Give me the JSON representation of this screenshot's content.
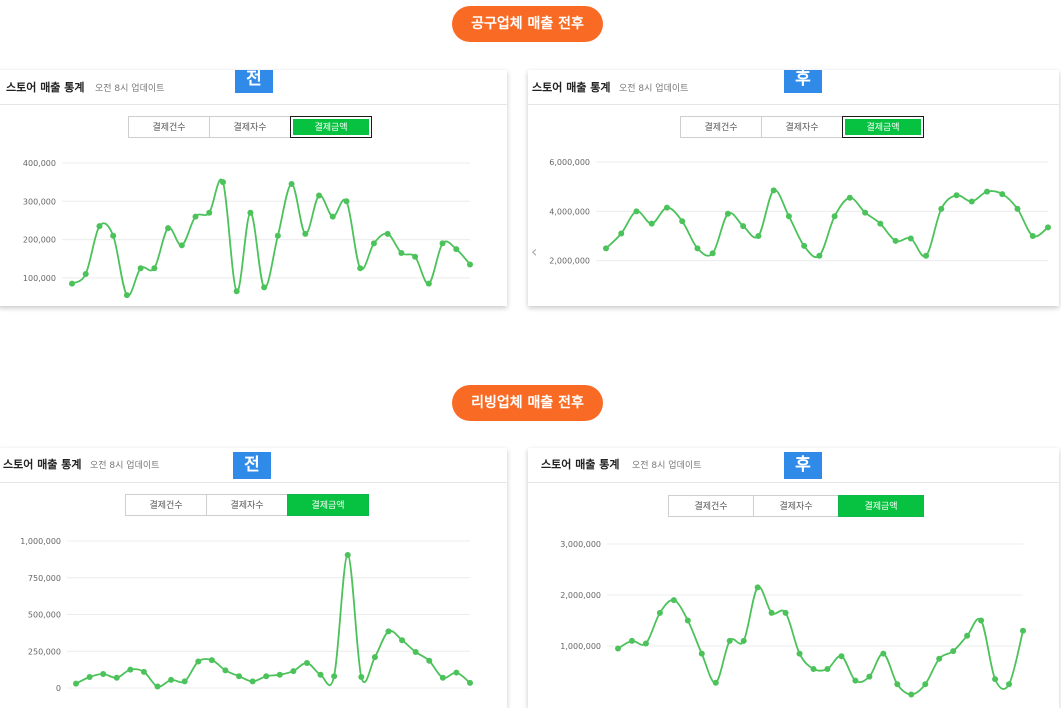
{
  "colors": {
    "badge": "#f96b24",
    "stage_badge": "#2f8ae8",
    "active_tab": "#07c140",
    "line": "#4cc25b",
    "grid": "#ececec"
  },
  "sections": [
    {
      "label": "공구업체 매출 전후"
    },
    {
      "label": "리빙업체 매출 전후"
    }
  ],
  "panels": [
    {
      "title": "스토어 매출 통계",
      "subtitle": "오전 8시 업데이트",
      "stage": "전",
      "tabs": [
        "결제건수",
        "결제자수",
        "결제금액"
      ],
      "active_tab": 2
    },
    {
      "title": "스토어 매출 통계",
      "subtitle": "오전 8시 업데이트",
      "stage": "후",
      "tabs": [
        "결제건수",
        "결제자수",
        "결제금액"
      ],
      "active_tab": 2,
      "nav_icon": "chevron-left-icon"
    },
    {
      "title": "스토어 매출 통계",
      "subtitle": "오전 8시 업데이트",
      "stage": "전",
      "tabs": [
        "결제건수",
        "결제자수",
        "결제금액"
      ],
      "active_tab": 2
    },
    {
      "title": "스토어 매출 통계",
      "subtitle": "오전 8시 업데이트",
      "stage": "후",
      "tabs": [
        "결제건수",
        "결제자수",
        "결제금액"
      ],
      "active_tab": 2
    }
  ],
  "chart_data": [
    {
      "type": "line",
      "ylim": [
        50000,
        400000
      ],
      "yticks": [
        100000,
        200000,
        300000,
        400000
      ],
      "ytick_labels": [
        "100,000",
        "200,000",
        "300,000",
        "400,000"
      ],
      "grid": true,
      "series": [
        {
          "values": [
            85000,
            110000,
            235000,
            210000,
            55000,
            125000,
            125000,
            230000,
            185000,
            260000,
            270000,
            350000,
            65000,
            270000,
            75000,
            210000,
            345000,
            215000,
            315000,
            260000,
            300000,
            125000,
            190000,
            215000,
            165000,
            155000,
            85000,
            190000,
            175000,
            135000
          ]
        }
      ]
    },
    {
      "type": "line",
      "ylim": [
        1500000,
        6000000
      ],
      "yticks": [
        2000000,
        4000000,
        6000000
      ],
      "ytick_labels": [
        "2,000,000",
        "4,000,000",
        "6,000,000"
      ],
      "grid": true,
      "series": [
        {
          "values": [
            2500000,
            3100000,
            4000000,
            3500000,
            4150000,
            3600000,
            2500000,
            2300000,
            3900000,
            3400000,
            3000000,
            4850000,
            3800000,
            2600000,
            2200000,
            3800000,
            4550000,
            3950000,
            3500000,
            2800000,
            2900000,
            2200000,
            4100000,
            4650000,
            4400000,
            4800000,
            4700000,
            4100000,
            3000000,
            3350000
          ]
        }
      ]
    },
    {
      "type": "line",
      "ylim": [
        0,
        1000000
      ],
      "yticks": [
        0,
        250000,
        500000,
        750000,
        1000000
      ],
      "ytick_labels": [
        "0",
        "250,000",
        "500,000",
        "750,000",
        "1,000,000"
      ],
      "grid": true,
      "series": [
        {
          "values": [
            30000,
            75000,
            95000,
            70000,
            125000,
            110000,
            10000,
            55000,
            45000,
            180000,
            190000,
            120000,
            80000,
            45000,
            80000,
            90000,
            115000,
            170000,
            90000,
            80000,
            905000,
            75000,
            210000,
            385000,
            325000,
            245000,
            185000,
            70000,
            105000,
            35000
          ]
        }
      ]
    },
    {
      "type": "line",
      "ylim": [
        0,
        3000000
      ],
      "yticks": [
        1000000,
        2000000,
        3000000
      ],
      "ytick_labels": [
        "1,000,000",
        "2,000,000",
        "3,000,000"
      ],
      "grid": true,
      "series": [
        {
          "values": [
            950000,
            1100000,
            1050000,
            1650000,
            1900000,
            1500000,
            850000,
            280000,
            1100000,
            1100000,
            2150000,
            1650000,
            1650000,
            850000,
            550000,
            550000,
            800000,
            320000,
            400000,
            850000,
            250000,
            50000,
            250000,
            750000,
            900000,
            1200000,
            1500000,
            350000,
            250000,
            1300000
          ]
        }
      ]
    }
  ]
}
